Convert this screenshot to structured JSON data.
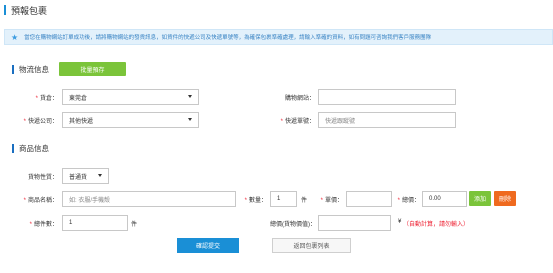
{
  "page": {
    "title": "預報包裹"
  },
  "notice": {
    "icon": "star-icon",
    "text": "當您在購物網站訂單成功後，請將購物網站的發貨訊息，如貨件的快遞公司及快遞單號等，為確保包裹準確處理，請輸入準確的資料，如有問題可咨詢我們客戶服務團隊"
  },
  "logistics": {
    "heading": "物流信息",
    "batch_button": "批量預存",
    "warehouse": {
      "label": "貨倉：",
      "value": "東莞倉"
    },
    "shop_site": {
      "label": "購物網站：",
      "value": ""
    },
    "courier": {
      "label": "快遞公司：",
      "value": "其他快遞"
    },
    "tracking": {
      "label": "快遞單號：",
      "placeholder": "快遞跟蹤號"
    }
  },
  "goods": {
    "heading": "商品信息",
    "nature": {
      "label": "貨物性質：",
      "value": "普通貨"
    },
    "name": {
      "label": "商品名稱：",
      "placeholder": "如: 衣服/手機殼"
    },
    "qty": {
      "label": "數量：",
      "value": "1",
      "unit": "件"
    },
    "unit_price": {
      "label": "單價：",
      "value": ""
    },
    "total_price": {
      "label": "總價：",
      "value": "0.00"
    },
    "add_button": "添加",
    "delete_button": "刪除",
    "pieces": {
      "label": "總件數：",
      "value": "1",
      "unit": "件"
    },
    "declared": {
      "label": "總價(貨物價值)：",
      "value": "",
      "currency": "¥"
    },
    "hint": "（自動計算，請勿輸入）"
  },
  "actions": {
    "submit": "確認提交",
    "back": "返回包裹列表"
  },
  "colors": {
    "primary": "#1a8fd6",
    "green": "#7bc43a",
    "orange": "#ef6a1f",
    "required": "#e22233",
    "notice_bg": "#e3f1fb"
  }
}
